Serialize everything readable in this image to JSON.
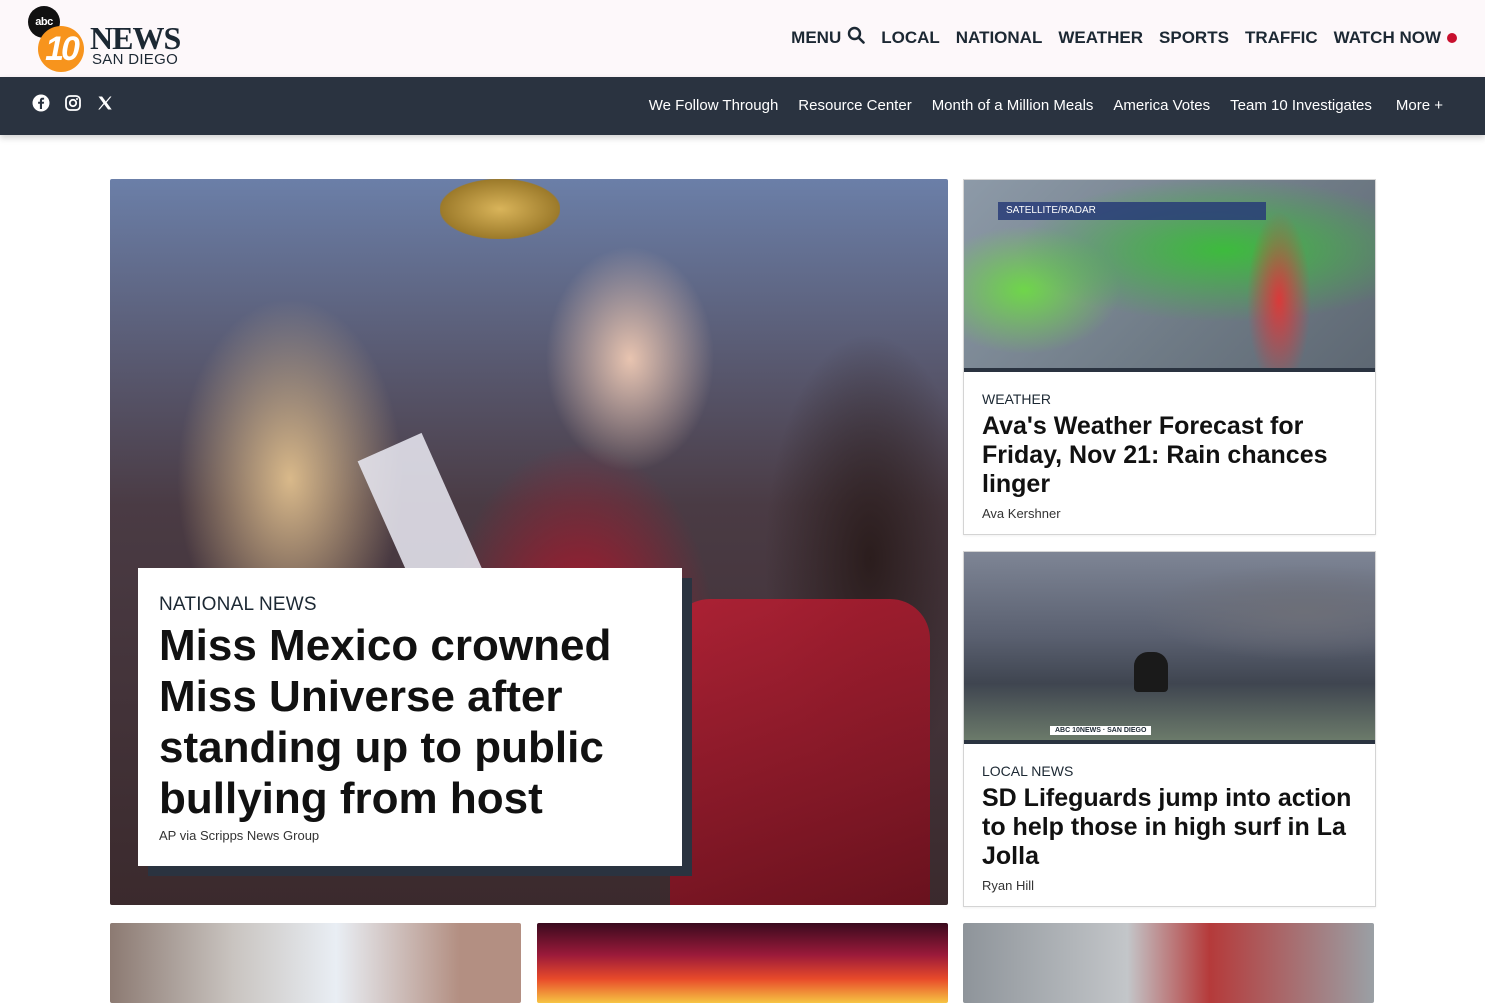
{
  "header": {
    "logo": {
      "badge": "abc",
      "number": "10",
      "name": "NEWS",
      "sub": "SAN DIEGO"
    },
    "nav": [
      {
        "label": "MENU"
      },
      {
        "label": "LOCAL"
      },
      {
        "label": "NATIONAL"
      },
      {
        "label": "WEATHER"
      },
      {
        "label": "SPORTS"
      },
      {
        "label": "TRAFFIC"
      },
      {
        "label": "WATCH NOW"
      }
    ],
    "live_color": "#c8102e"
  },
  "subnav": {
    "social": [
      "facebook-icon",
      "instagram-icon",
      "x-icon"
    ],
    "items": [
      {
        "label": "We Follow Through"
      },
      {
        "label": "Resource Center"
      },
      {
        "label": "Month of a Million Meals"
      },
      {
        "label": "America Votes"
      },
      {
        "label": "Team 10 Investigates"
      },
      {
        "label": "More +"
      }
    ]
  },
  "hero": {
    "category": "NATIONAL NEWS",
    "headline": "Miss Mexico crowned Miss Universe after standing up to public bullying from host",
    "byline": "AP via Scripps News Group"
  },
  "cards": [
    {
      "category": "WEATHER",
      "headline": "Ava's Weather Forecast for Friday, Nov 21: Rain chances linger",
      "byline": "Ava Kershner",
      "thumb_label": "SATELLITE/RADAR"
    },
    {
      "category": "LOCAL NEWS",
      "headline": "SD Lifeguards jump into action to help those in high surf in La Jolla",
      "byline": "Ryan Hill",
      "thumb_tag": "ABC 10NEWS · SAN DIEGO"
    }
  ],
  "colors": {
    "navy": "#2a3340",
    "orange": "#f7941d"
  }
}
